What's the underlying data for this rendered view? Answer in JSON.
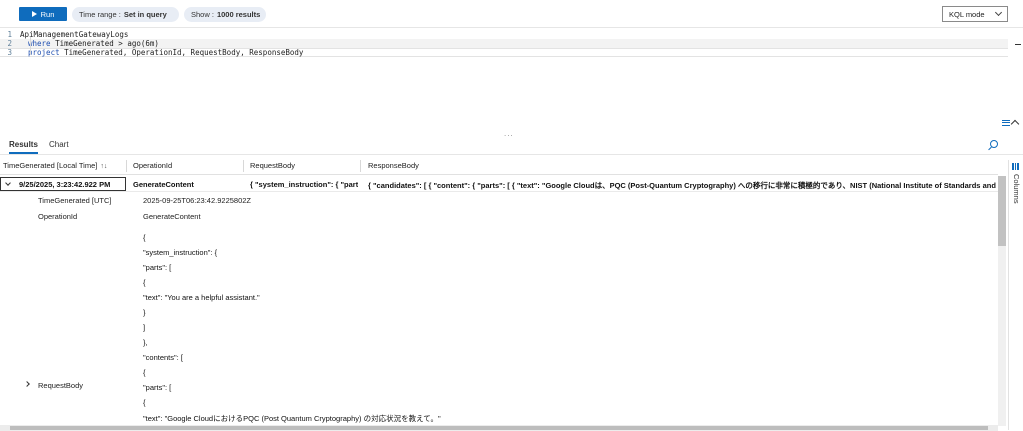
{
  "toolbar": {
    "run_label": "Run",
    "time_range_label": "Time range :",
    "time_range_value": "Set in query",
    "show_label": "Show :",
    "show_value": "1000 results",
    "mode_value": "KQL mode"
  },
  "editor": {
    "lines": [
      {
        "num": "1",
        "text": "ApiManagementGatewayLogs"
      },
      {
        "num": "2",
        "kw": "where",
        "text": " TimeGenerated > ago(6m)"
      },
      {
        "num": "3",
        "kw": "project",
        "text": " TimeGenerated, OperationId, RequestBody, ResponseBody"
      }
    ],
    "splitter": "..."
  },
  "tabs": {
    "results": "Results",
    "chart": "Chart"
  },
  "table": {
    "headers": [
      "TimeGenerated [Local Time]",
      "OperationId",
      "RequestBody",
      "ResponseBody"
    ],
    "sort_glyph": "↑↓",
    "row": {
      "time": "9/25/2025, 3:23:42.922 PM",
      "operation": "GenerateContent",
      "request": "{ \"system_instruction\": { \"parts...",
      "response": "{ \"candidates\": [ { \"content\": { \"parts\": [ { \"text\": \"Google Cloudは、PQC (Post-Quantum Cryptography) への移行に非常に積極的であり、NIST (National Institute of Standards and Technology) の標準化プ..."
    }
  },
  "detail": {
    "time_utc_label": "TimeGenerated [UTC]",
    "time_utc_value": "2025-09-25T06:23:42.9225802Z",
    "operation_label": "OperationId",
    "operation_value": "GenerateContent",
    "request_label": "RequestBody",
    "request_json": [
      "{",
      "\"system_instruction\": {",
      "\"parts\": [",
      "{",
      "\"text\": \"You are a helpful assistant.\"",
      "}",
      "]",
      "},",
      "\"contents\": [",
      "{",
      "\"parts\": [",
      "{",
      "\"text\": \"Google CloudにおけるPQC (Post Quantum Cryptography) の対応状況を教えて。\""
    ]
  },
  "columns_label": "Columns"
}
